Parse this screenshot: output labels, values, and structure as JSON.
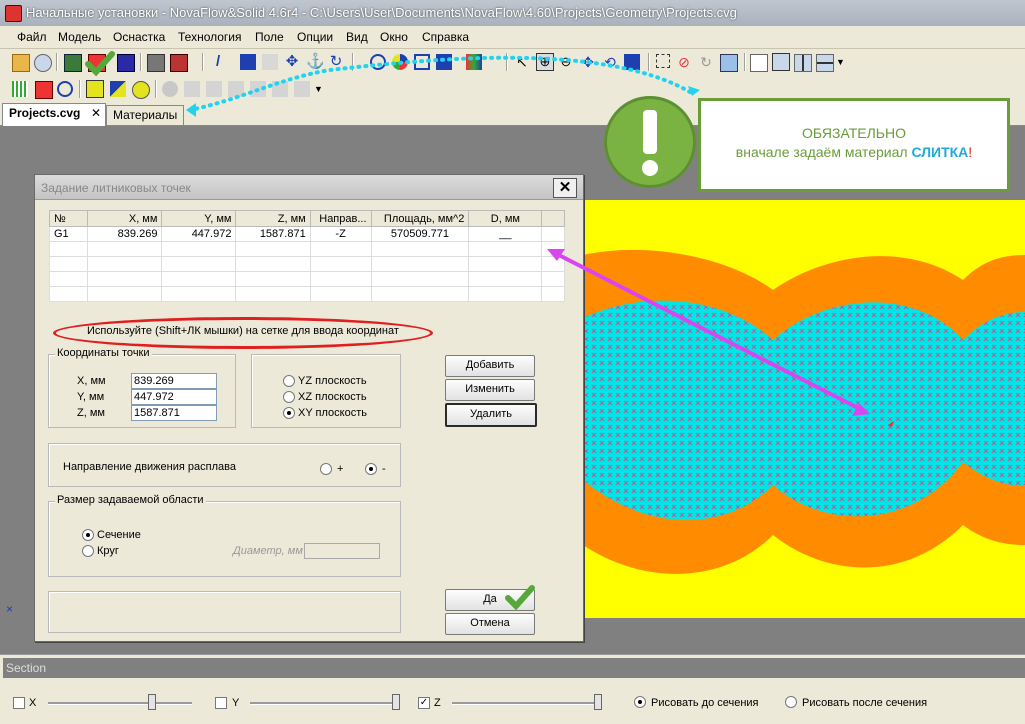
{
  "window": {
    "title": "Начальные установки - NovaFlow&Solid 4.6r4 - C:\\Users\\User\\Documents\\NovaFlow\\4.60\\Projects\\Geometry\\Projects.cvg"
  },
  "menu": [
    "Файл",
    "Модель",
    "Оснастка",
    "Технология",
    "Поле",
    "Опции",
    "Вид",
    "Окно",
    "Справка"
  ],
  "tabs": [
    {
      "label": "Projects.cvg",
      "close": "✕"
    },
    {
      "label": "Материалы"
    }
  ],
  "callout": {
    "line1": "ОБЯЗАТЕЛЬНО",
    "line2_a": "вначале задаём материал ",
    "line2_b": "СЛИТКА",
    "line2_c": "!"
  },
  "dialog": {
    "title": "Задание литниковых точек",
    "close": "✕",
    "columns": [
      "№",
      "X, мм",
      "Y, мм",
      "Z, мм",
      "Направ...",
      "Площадь, мм^2",
      "D, мм"
    ],
    "rows": [
      [
        "G1",
        "839.269",
        "447.972",
        "1587.871",
        "-Z",
        "570509.771",
        "__"
      ]
    ],
    "hint": "Используйте (Shift+ЛК мышки) на сетке для ввода координат",
    "coords": {
      "caption": "Координаты точки",
      "x_label": "X, мм",
      "x": "839.269",
      "y_label": "Y, мм",
      "y": "447.972",
      "z_label": "Z, мм",
      "z": "1587.871"
    },
    "planes": {
      "yz": "YZ плоскость",
      "xz": "XZ плоскость",
      "xy": "XY плоскость",
      "selected": "xy"
    },
    "buttons": {
      "add": "Добавить",
      "change": "Изменить",
      "delete": "Удалить",
      "ok": "Да",
      "cancel": "Отмена"
    },
    "direction": {
      "label": "Направление движения расплава",
      "plus": "+",
      "minus": "-",
      "selected": "minus"
    },
    "area": {
      "caption": "Размер задаваемой области",
      "section": "Сечение",
      "circle": "Круг",
      "diameter": "Диаметр, мм",
      "selected": "section"
    }
  },
  "section": {
    "label": "Section",
    "x": "X",
    "y": "Y",
    "z": "Z",
    "x_checked": false,
    "y_checked": false,
    "z_checked": true,
    "draw_before": "Рисовать до сечения",
    "draw_after": "Рисовать после сечения",
    "draw_selected": "before"
  },
  "colors": {
    "accent": "#6a9c3a",
    "mold": "#ffff00",
    "casting": "#ff8c00",
    "cavity": "#00e5e5",
    "annotation_dots": "#22d3ee",
    "arrow": "#d946ef",
    "oval": "#e02020"
  }
}
